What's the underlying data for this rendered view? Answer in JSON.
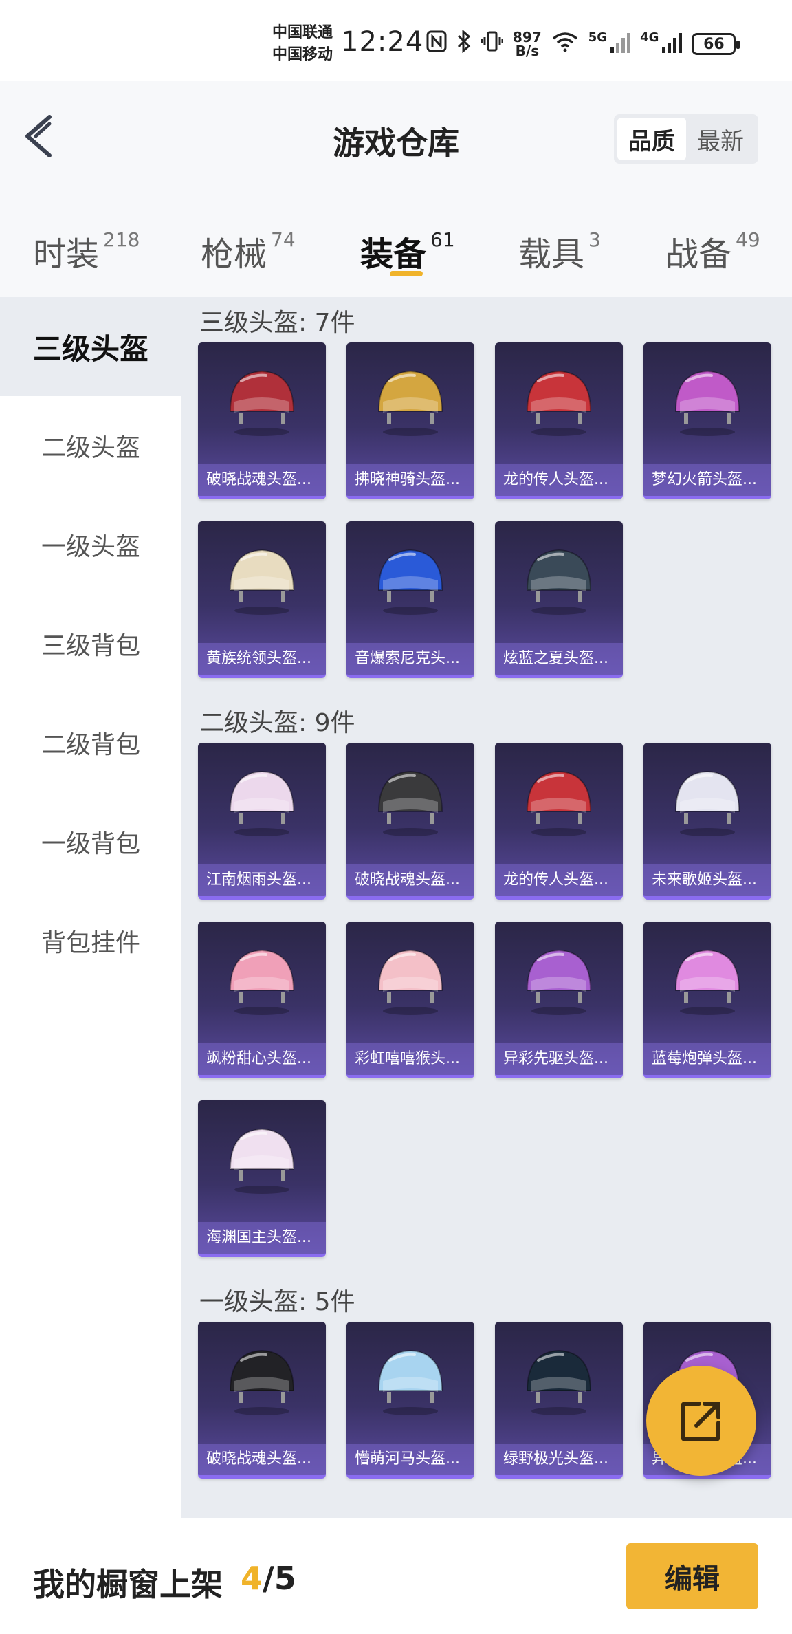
{
  "status_bar": {
    "carrier_1": "中国联通",
    "carrier_2": "中国移动",
    "time": "12:24",
    "speed_value": "897",
    "speed_unit": "B/s",
    "net_5g": "5G",
    "net_4g": "4G",
    "battery": "66"
  },
  "header": {
    "title": "游戏仓库",
    "sort_quality": "品质",
    "sort_newest": "最新"
  },
  "tabs": [
    {
      "label": "时装",
      "count": "218"
    },
    {
      "label": "枪械",
      "count": "74"
    },
    {
      "label": "装备",
      "count": "61"
    },
    {
      "label": "载具",
      "count": "3"
    },
    {
      "label": "战备",
      "count": "49"
    }
  ],
  "active_tab": "装备",
  "sidebar": [
    {
      "label": "三级头盔",
      "active": true
    },
    {
      "label": "二级头盔",
      "active": false
    },
    {
      "label": "一级头盔",
      "active": false
    },
    {
      "label": "三级背包",
      "active": false
    },
    {
      "label": "二级背包",
      "active": false
    },
    {
      "label": "一级背包",
      "active": false
    },
    {
      "label": "背包挂件",
      "active": false
    }
  ],
  "sections": [
    {
      "title": "三级头盔: 7件",
      "items": [
        {
          "name": "破晓战魂头盔...",
          "icon": "helmet-icon",
          "color": "#b0303a"
        },
        {
          "name": "拂晓神骑头盔...",
          "icon": "helmet-icon",
          "color": "#d4a640"
        },
        {
          "name": "龙的传人头盔...",
          "icon": "helmet-icon",
          "color": "#c8343a"
        },
        {
          "name": "梦幻火箭头盔...",
          "icon": "helmet-icon",
          "color": "#c05ac8"
        },
        {
          "name": "黄族统领头盔...",
          "icon": "helmet-icon",
          "color": "#e8dcc0"
        },
        {
          "name": "音爆索尼克头...",
          "icon": "helmet-icon",
          "color": "#2a5ad8"
        },
        {
          "name": "炫蓝之夏头盔...",
          "icon": "helmet-icon",
          "color": "#3a4a58"
        }
      ]
    },
    {
      "title": "二级头盔: 9件",
      "items": [
        {
          "name": "江南烟雨头盔...",
          "icon": "helmet-icon",
          "color": "#ecd8ec"
        },
        {
          "name": "破晓战魂头盔...",
          "icon": "helmet-icon",
          "color": "#3a3a3c"
        },
        {
          "name": "龙的传人头盔...",
          "icon": "helmet-icon",
          "color": "#c8343a"
        },
        {
          "name": "未来歌姬头盔...",
          "icon": "helmet-icon",
          "color": "#e4e4f0"
        },
        {
          "name": "飒粉甜心头盔...",
          "icon": "helmet-icon",
          "color": "#f0a0b8"
        },
        {
          "name": "彩虹嘻嘻猴头...",
          "icon": "helmet-icon",
          "color": "#f4c0c8"
        },
        {
          "name": "异彩先驱头盔...",
          "icon": "helmet-icon",
          "color": "#a860d0"
        },
        {
          "name": "蓝莓炮弹头盔...",
          "icon": "helmet-icon",
          "color": "#e08ae0"
        },
        {
          "name": "海渊国主头盔...",
          "icon": "helmet-icon",
          "color": "#f0e0f0"
        }
      ]
    },
    {
      "title": "一级头盔: 5件",
      "items": [
        {
          "name": "破晓战魂头盔...",
          "icon": "helmet-icon",
          "color": "#222226"
        },
        {
          "name": "懵萌河马头盔...",
          "icon": "helmet-icon",
          "color": "#a8d4f0"
        },
        {
          "name": "绿野极光头盔...",
          "icon": "helmet-icon",
          "color": "#1a2a3a"
        },
        {
          "name": "异彩先驱头盔...",
          "icon": "helmet-icon",
          "color": "#a860d0"
        }
      ]
    }
  ],
  "bottom": {
    "label": "我的橱窗上架",
    "current": "4",
    "sep_total": "/5",
    "edit": "编辑"
  },
  "colors": {
    "accent": "#f2b535",
    "card_top": "#2b2647",
    "card_bottom": "#5a4a9e"
  }
}
